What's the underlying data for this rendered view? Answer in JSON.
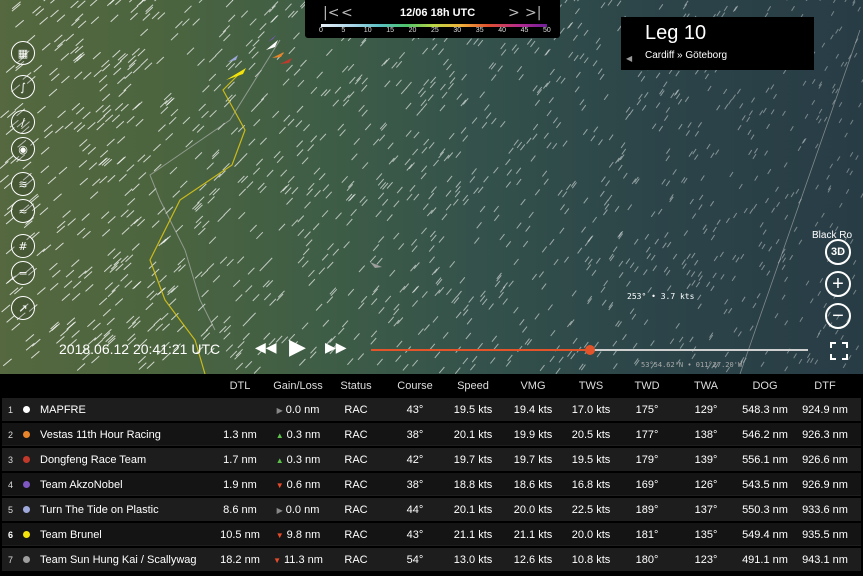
{
  "timeline": {
    "date": "12/06 18h UTC",
    "first_label": "|<",
    "prev_label": "<",
    "next_label": ">",
    "last_label": ">|",
    "scale": [
      "0",
      "5",
      "10",
      "15",
      "20",
      "25",
      "30",
      "35",
      "40",
      "45",
      "50"
    ]
  },
  "leg": {
    "title": "Leg 10",
    "route": "Cardiff » Göteborg",
    "arrow": "◀"
  },
  "map": {
    "place_label": "Black Ro",
    "wind_readout": "253° • 3.7 kts",
    "coords": "53°54.62'N • 011°27.20'W",
    "view_3d_label": "3D",
    "zoom_in_label": "+",
    "zoom_out_label": "−"
  },
  "playback": {
    "clock": "2018.06.12 20:41:21 UTC",
    "rewind": "◀◀",
    "play": "▶",
    "forward": "▶▶",
    "progress": 0.5
  },
  "table": {
    "headers": [
      "DTL",
      "Gain/Loss",
      "Status",
      "Course",
      "Speed",
      "VMG",
      "TWS",
      "TWD",
      "TWA",
      "DOG",
      "DTF"
    ],
    "rows": [
      {
        "rank": "1",
        "name": "MAPFRE",
        "color": "#ffffff",
        "dtl": "",
        "gl_dir": "flat",
        "gl": "0.0 nm",
        "status": "RAC",
        "course": "43°",
        "speed": "19.5 kts",
        "vmg": "19.4 kts",
        "tws": "17.0 kts",
        "twd": "175°",
        "twa": "129°",
        "dog": "548.3 nm",
        "dtf": "924.9 nm"
      },
      {
        "rank": "2",
        "name": "Vestas 11th Hour Racing",
        "color": "#e8852a",
        "dtl": "1.3 nm",
        "gl_dir": "up",
        "gl": "0.3 nm",
        "status": "RAC",
        "course": "38°",
        "speed": "20.1 kts",
        "vmg": "19.9 kts",
        "tws": "20.5 kts",
        "twd": "177°",
        "twa": "138°",
        "dog": "546.2 nm",
        "dtf": "926.3 nm"
      },
      {
        "rank": "3",
        "name": "Dongfeng Race Team",
        "color": "#c0392b",
        "dtl": "1.7 nm",
        "gl_dir": "up",
        "gl": "0.3 nm",
        "status": "RAC",
        "course": "42°",
        "speed": "19.7 kts",
        "vmg": "19.7 kts",
        "tws": "19.5 kts",
        "twd": "179°",
        "twa": "139°",
        "dog": "556.1 nm",
        "dtf": "926.6 nm"
      },
      {
        "rank": "4",
        "name": "Team AkzoNobel",
        "color": "#7e57c2",
        "dtl": "1.9 nm",
        "gl_dir": "down",
        "gl": "0.6 nm",
        "status": "RAC",
        "course": "38°",
        "speed": "18.8 kts",
        "vmg": "18.6 kts",
        "tws": "16.8 kts",
        "twd": "169°",
        "twa": "126°",
        "dog": "543.5 nm",
        "dtf": "926.9 nm"
      },
      {
        "rank": "5",
        "name": "Turn The Tide on Plastic",
        "color": "#9fa8da",
        "dtl": "8.6 nm",
        "gl_dir": "flat",
        "gl": "0.0 nm",
        "status": "RAC",
        "course": "44°",
        "speed": "20.1 kts",
        "vmg": "20.0 kts",
        "tws": "22.5 kts",
        "twd": "189°",
        "twa": "137°",
        "dog": "550.3 nm",
        "dtf": "933.6 nm"
      },
      {
        "rank": "6",
        "name": "Team Brunel",
        "color": "#f4e20a",
        "dtl": "10.5 nm",
        "gl_dir": "down",
        "gl": "9.8 nm",
        "status": "RAC",
        "course": "43°",
        "speed": "21.1 kts",
        "vmg": "21.1 kts",
        "tws": "20.0 kts",
        "twd": "181°",
        "twa": "135°",
        "dog": "549.4 nm",
        "dtf": "935.5 nm"
      },
      {
        "rank": "7",
        "name": "Team Sun Hung Kai / Scallywag",
        "color": "#9e9e9e",
        "dtl": "18.2 nm",
        "gl_dir": "down",
        "gl": "11.3 nm",
        "status": "RAC",
        "course": "54°",
        "speed": "13.0 kts",
        "vmg": "12.6 kts",
        "tws": "10.8 kts",
        "twd": "180°",
        "twa": "123°",
        "dog": "491.1 nm",
        "dtf": "943.1 nm"
      }
    ]
  },
  "icons": {
    "up": "▲",
    "down": "▼",
    "flat": "▶",
    "up_color": "#5cc24a",
    "down_color": "#e54b2a",
    "flat_color": "#888888"
  }
}
